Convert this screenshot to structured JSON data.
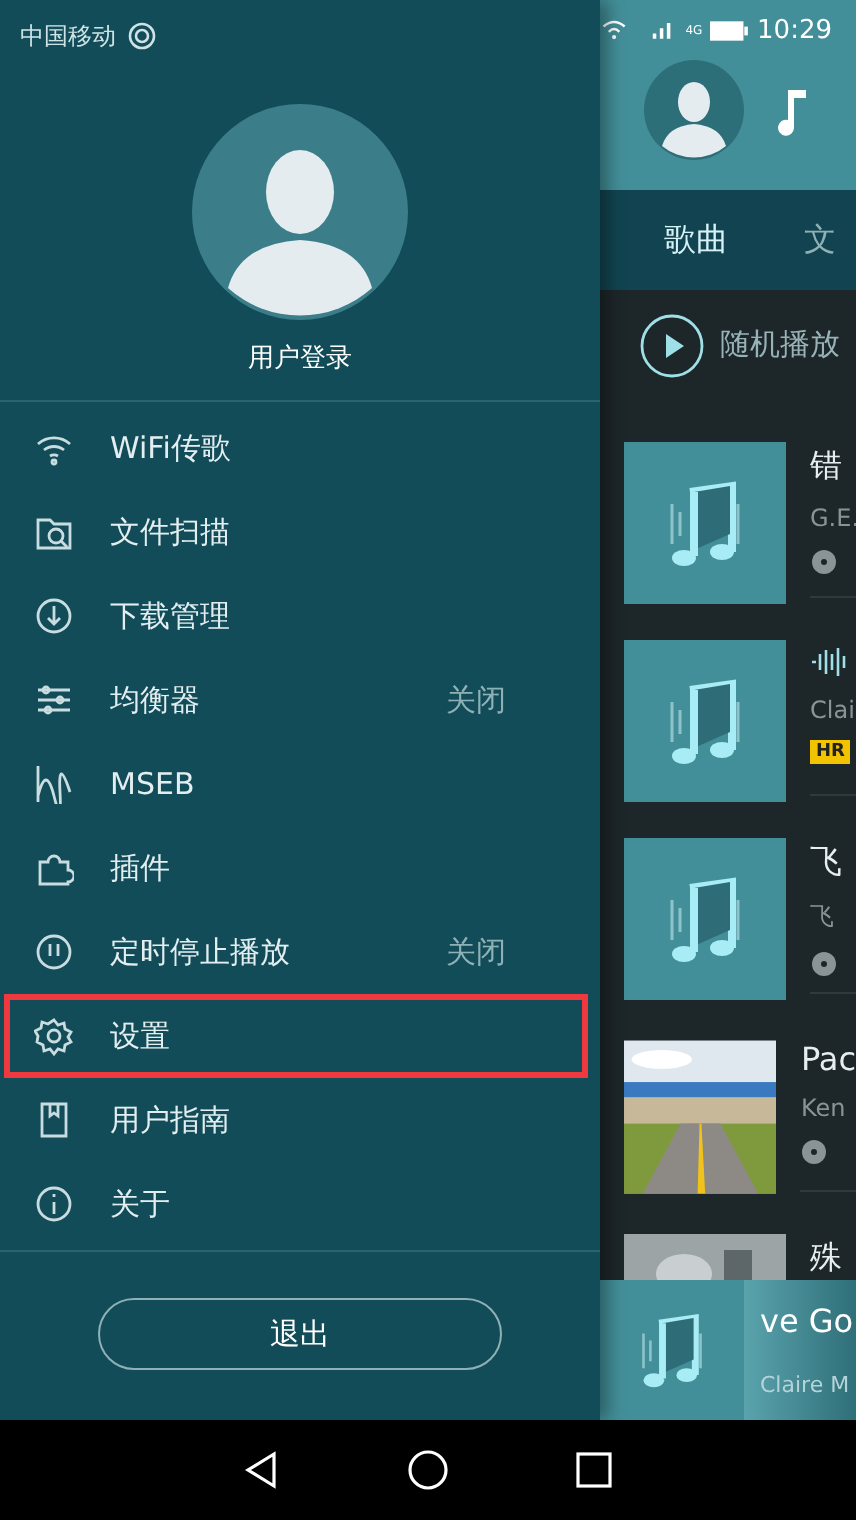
{
  "status_bar": {
    "carrier": "中国移动",
    "network": "4G",
    "time": "10:29"
  },
  "drawer": {
    "user_label": "用户登录",
    "menu": [
      {
        "label": "WiFi传歌",
        "highlighted": false
      },
      {
        "label": "文件扫描",
        "highlighted": false
      },
      {
        "label": "下载管理",
        "highlighted": false
      },
      {
        "label": "均衡器",
        "value": "关闭",
        "highlighted": false
      },
      {
        "label": "MSEB",
        "highlighted": false
      },
      {
        "label": "插件",
        "highlighted": false
      },
      {
        "label": "定时停止播放",
        "value": "关闭",
        "highlighted": false
      },
      {
        "label": "设置",
        "highlighted": true
      },
      {
        "label": "用户指南",
        "highlighted": false
      },
      {
        "label": "关于",
        "highlighted": false
      }
    ],
    "logout_button": "退出"
  },
  "library": {
    "tabs": [
      {
        "label": "歌曲",
        "selected": true
      },
      {
        "label": "文",
        "selected": false
      }
    ],
    "shuffle_label": "随机播放",
    "songs": [
      {
        "kind": "local",
        "title": "错",
        "artist": "G.E."
      },
      {
        "kind": "hires",
        "artist": "Clai",
        "badge": "HR"
      },
      {
        "kind": "local",
        "title": "飞",
        "artist": "飞"
      },
      {
        "kind": "album",
        "title": "Pac",
        "artist": "Ken"
      },
      {
        "kind": "album",
        "title": "殊"
      }
    ]
  },
  "mini_player": {
    "title": "ve Go",
    "artist": "Claire M"
  }
}
